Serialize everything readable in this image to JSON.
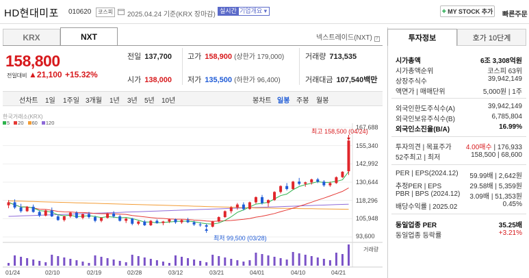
{
  "header": {
    "company_name": "HD현대미포",
    "code": "010620",
    "market_tag": "코스피",
    "date_text": "2025.04.24  기준(KRX 장마감)",
    "realtime_tag": "실시간",
    "overview_tag": "기업개요",
    "mystock_label": "MY STOCK 추가",
    "quick_order": "빠른주문"
  },
  "market_tabs": {
    "krx": "KRX",
    "nxt": "NXT"
  },
  "nxt_link": "넥스트레이드(NXT)",
  "quote": {
    "price": "158,800",
    "change_label": "전일대비",
    "change_value": "21,100",
    "change_pct": "+15.32%",
    "prev_close_label": "전일",
    "prev_close": "137,700",
    "open_label": "시가",
    "open": "138,000",
    "high_label": "고가",
    "high": "158,900",
    "high_limit": "(상한가 179,000)",
    "low_label": "저가",
    "low": "135,500",
    "low_limit": "(하한가 96,400)",
    "volume_label": "거래량",
    "volume": "713,535",
    "amount_label": "거래대금",
    "amount": "107,540",
    "amount_unit": "백만"
  },
  "period_bar": {
    "items": [
      "선차트",
      "1일",
      "1주일",
      "3개월",
      "1년",
      "3년",
      "5년",
      "10년"
    ],
    "candle_label": "봉차트",
    "candle_items": [
      "일봉",
      "주봉",
      "월봉"
    ]
  },
  "chart_data": {
    "type": "candlestick",
    "source": "한국거래소(KRX)",
    "ma_legend": [
      {
        "name": "5",
        "color": "#2db24c"
      },
      {
        "name": "20",
        "color": "#e53935"
      },
      {
        "name": "60",
        "color": "#f39c34"
      },
      {
        "name": "120",
        "color": "#8e6ad8"
      }
    ],
    "y_ticks": [
      "167,688",
      "155,340",
      "142,992",
      "130,644",
      "118,296",
      "105,948",
      "93,600"
    ],
    "ylim": [
      93600,
      167688
    ],
    "x_ticks": [
      "01/24",
      "02/10",
      "02/19",
      "02/28",
      "03/12",
      "03/21",
      "04/01",
      "04/10",
      "04/21"
    ],
    "max_annotation": "최고 158,500 (04/24)",
    "min_annotation": "최저 99,500 (03/28)",
    "volume_label": "거래량",
    "candles": [
      [
        115000,
        118500,
        113000,
        117000
      ],
      [
        117000,
        119000,
        112500,
        113500
      ],
      [
        113500,
        116000,
        110000,
        111000
      ],
      [
        111000,
        114500,
        110500,
        114000
      ],
      [
        114000,
        115500,
        110000,
        110500
      ],
      [
        110500,
        111500,
        107000,
        108000
      ],
      [
        108000,
        112000,
        107500,
        111500
      ],
      [
        111500,
        113500,
        107000,
        107500
      ],
      [
        107500,
        108500,
        104500,
        105000
      ],
      [
        105000,
        108000,
        104000,
        107500
      ],
      [
        107500,
        110500,
        106500,
        110000
      ],
      [
        110000,
        111000,
        106000,
        106500
      ],
      [
        106500,
        109500,
        105500,
        109000
      ],
      [
        109000,
        110500,
        106000,
        107000
      ],
      [
        107000,
        108000,
        103500,
        104500
      ],
      [
        104500,
        107000,
        103500,
        106500
      ],
      [
        106500,
        110000,
        106000,
        109500
      ],
      [
        109500,
        111000,
        106500,
        107500
      ],
      [
        107500,
        108500,
        104000,
        104500
      ],
      [
        104500,
        106500,
        103000,
        106000
      ],
      [
        106000,
        106500,
        101500,
        102500
      ],
      [
        102500,
        104500,
        101500,
        104000
      ],
      [
        104000,
        105000,
        101000,
        101500
      ],
      [
        101500,
        105000,
        101000,
        104500
      ],
      [
        104500,
        105500,
        102500,
        103000
      ],
      [
        103000,
        104500,
        101500,
        104000
      ],
      [
        104000,
        106000,
        103000,
        105500
      ],
      [
        105500,
        106000,
        102500,
        103500
      ],
      [
        103500,
        105500,
        102500,
        105000
      ],
      [
        105000,
        106500,
        103000,
        103500
      ],
      [
        103500,
        104500,
        101000,
        102000
      ],
      [
        102000,
        103500,
        100500,
        101500
      ],
      [
        101500,
        102500,
        99500,
        100500
      ],
      [
        100500,
        104500,
        100000,
        104000
      ],
      [
        104000,
        107500,
        103500,
        107000
      ],
      [
        107000,
        111500,
        106500,
        111000
      ],
      [
        111000,
        114500,
        109500,
        113500
      ],
      [
        113500,
        116500,
        112000,
        115500
      ],
      [
        115500,
        117000,
        111500,
        112500
      ],
      [
        112500,
        117500,
        112000,
        117000
      ],
      [
        117000,
        121000,
        116000,
        120500
      ],
      [
        120500,
        122000,
        115500,
        116500
      ],
      [
        116500,
        119000,
        114000,
        118500
      ],
      [
        118500,
        124500,
        118000,
        124000
      ],
      [
        124000,
        128500,
        123000,
        128000
      ],
      [
        128000,
        130000,
        125000,
        126000
      ],
      [
        126000,
        131500,
        125500,
        131000
      ],
      [
        131000,
        133500,
        128500,
        129500
      ],
      [
        129500,
        131000,
        127500,
        130500
      ],
      [
        130500,
        133000,
        129000,
        132500
      ],
      [
        132500,
        133500,
        130000,
        131000
      ],
      [
        131000,
        132000,
        127500,
        128500
      ],
      [
        128500,
        131000,
        127500,
        130000
      ],
      [
        130000,
        134500,
        129500,
        134000
      ],
      [
        134000,
        138000,
        133500,
        137700
      ],
      [
        138000,
        158900,
        135500,
        158800
      ]
    ]
  },
  "side": {
    "tab_active": "투자정보",
    "tab_other": "호가 10단계",
    "rows_1": [
      {
        "l": "시가총액",
        "r": "6조 3,308억원"
      },
      {
        "l": "시가총액순위",
        "r": "코스피 63위"
      },
      {
        "l": "상장주식수",
        "r": "39,942,149"
      },
      {
        "l": "액면가 | 매매단위",
        "r": "5,000원 | 1주"
      }
    ],
    "rows_2": [
      {
        "l": "외국인한도주식수(A)",
        "r": "39,942,149"
      },
      {
        "l": "외국인보유주식수(B)",
        "r": "6,785,804"
      },
      {
        "l": "외국인소진율(B/A)",
        "r": "16.99%",
        "bold": true
      }
    ],
    "rows_3": [
      {
        "l": "투자의견 | 목표주가",
        "r_red": "4.00매수",
        "r": " | 176,933"
      },
      {
        "l": "52주최고 | 최저",
        "r": "158,500 | 68,600"
      }
    ],
    "rows_4": [
      {
        "l": "PER | EPS(2024.12)",
        "r": "59.99배 | 2,642원"
      },
      {
        "l": "추정PER | EPS",
        "r": "29.58배 | 5,359원"
      },
      {
        "l": "PBR | BPS (2024.12)",
        "r": "3.09배 | 51,353원"
      },
      {
        "l": "배당수익률 | 2025.02",
        "r": "0.45%"
      }
    ],
    "rows_5": [
      {
        "l": "동일업종 PER",
        "r": "35.25배",
        "bold": true
      },
      {
        "l": "동일업종 등락률",
        "r": "+3.21%",
        "red": true
      }
    ]
  }
}
